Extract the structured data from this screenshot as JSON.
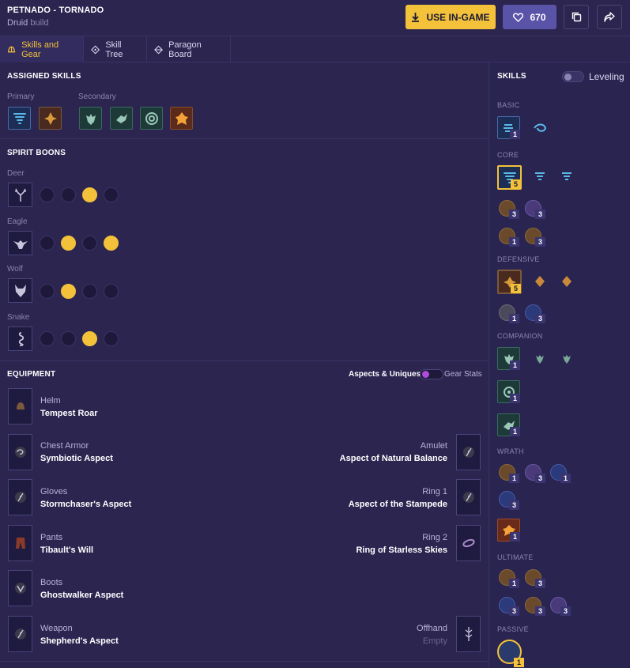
{
  "header": {
    "title": "PETNADO - TORNADO",
    "class_name": "Druid",
    "build_word": "build",
    "use_in_game": "USE IN-GAME",
    "likes": "670"
  },
  "tabs": [
    {
      "label": "Skills and Gear"
    },
    {
      "label": "Skill Tree"
    },
    {
      "label": "Paragon Board"
    }
  ],
  "assigned": {
    "title": "ASSIGNED SKILLS",
    "primary": "Primary",
    "secondary": "Secondary"
  },
  "boons": {
    "title": "SPIRIT BOONS",
    "groups": [
      {
        "name": "Deer",
        "selected": [
          3
        ]
      },
      {
        "name": "Eagle",
        "selected": [
          2,
          4
        ]
      },
      {
        "name": "Wolf",
        "selected": [
          2
        ]
      },
      {
        "name": "Snake",
        "selected": [
          3
        ]
      }
    ]
  },
  "equipment": {
    "title": "EQUIPMENT",
    "toggle_left": "Aspects & Uniques",
    "toggle_right": "Gear Stats",
    "left": [
      {
        "slot": "Helm",
        "name": "Tempest Roar"
      },
      {
        "slot": "Chest Armor",
        "name": "Symbiotic Aspect"
      },
      {
        "slot": "Gloves",
        "name": "Stormchaser's Aspect"
      },
      {
        "slot": "Pants",
        "name": "Tibault's Will"
      },
      {
        "slot": "Boots",
        "name": "Ghostwalker Aspect"
      },
      {
        "slot": "Weapon",
        "name": "Shepherd's Aspect"
      }
    ],
    "right": [
      {
        "slot": "Amulet",
        "name": "Aspect of Natural Balance"
      },
      {
        "slot": "Ring 1",
        "name": "Aspect of the Stampede"
      },
      {
        "slot": "Ring 2",
        "name": "Ring of Starless Skies"
      },
      {
        "slot": "Offhand",
        "name": "Empty"
      }
    ]
  },
  "skills_panel": {
    "title": "SKILLS",
    "leveling": "Leveling",
    "sections": {
      "basic": "BASIC",
      "core": "CORE",
      "defensive": "DEFENSIVE",
      "companion": "COMPANION",
      "wrath": "WRATH",
      "ultimate": "ULTIMATE",
      "passive": "PASSIVE"
    },
    "ranks": {
      "basic": "1",
      "core": "5",
      "core_r1a": "3",
      "core_r1b": "3",
      "core_r2a": "1",
      "core_r2b": "3",
      "def": "5",
      "def_r1a": "1",
      "def_r1b": "3",
      "comp1": "1",
      "comp2": "1",
      "comp3": "1",
      "wr1": "1",
      "wr2": "3",
      "wr3": "1",
      "wr4": "3",
      "wr5": "1",
      "ul1": "1",
      "ul2": "3",
      "ul3": "3",
      "ul4": "3",
      "ul5": "3",
      "passive": "1"
    }
  }
}
